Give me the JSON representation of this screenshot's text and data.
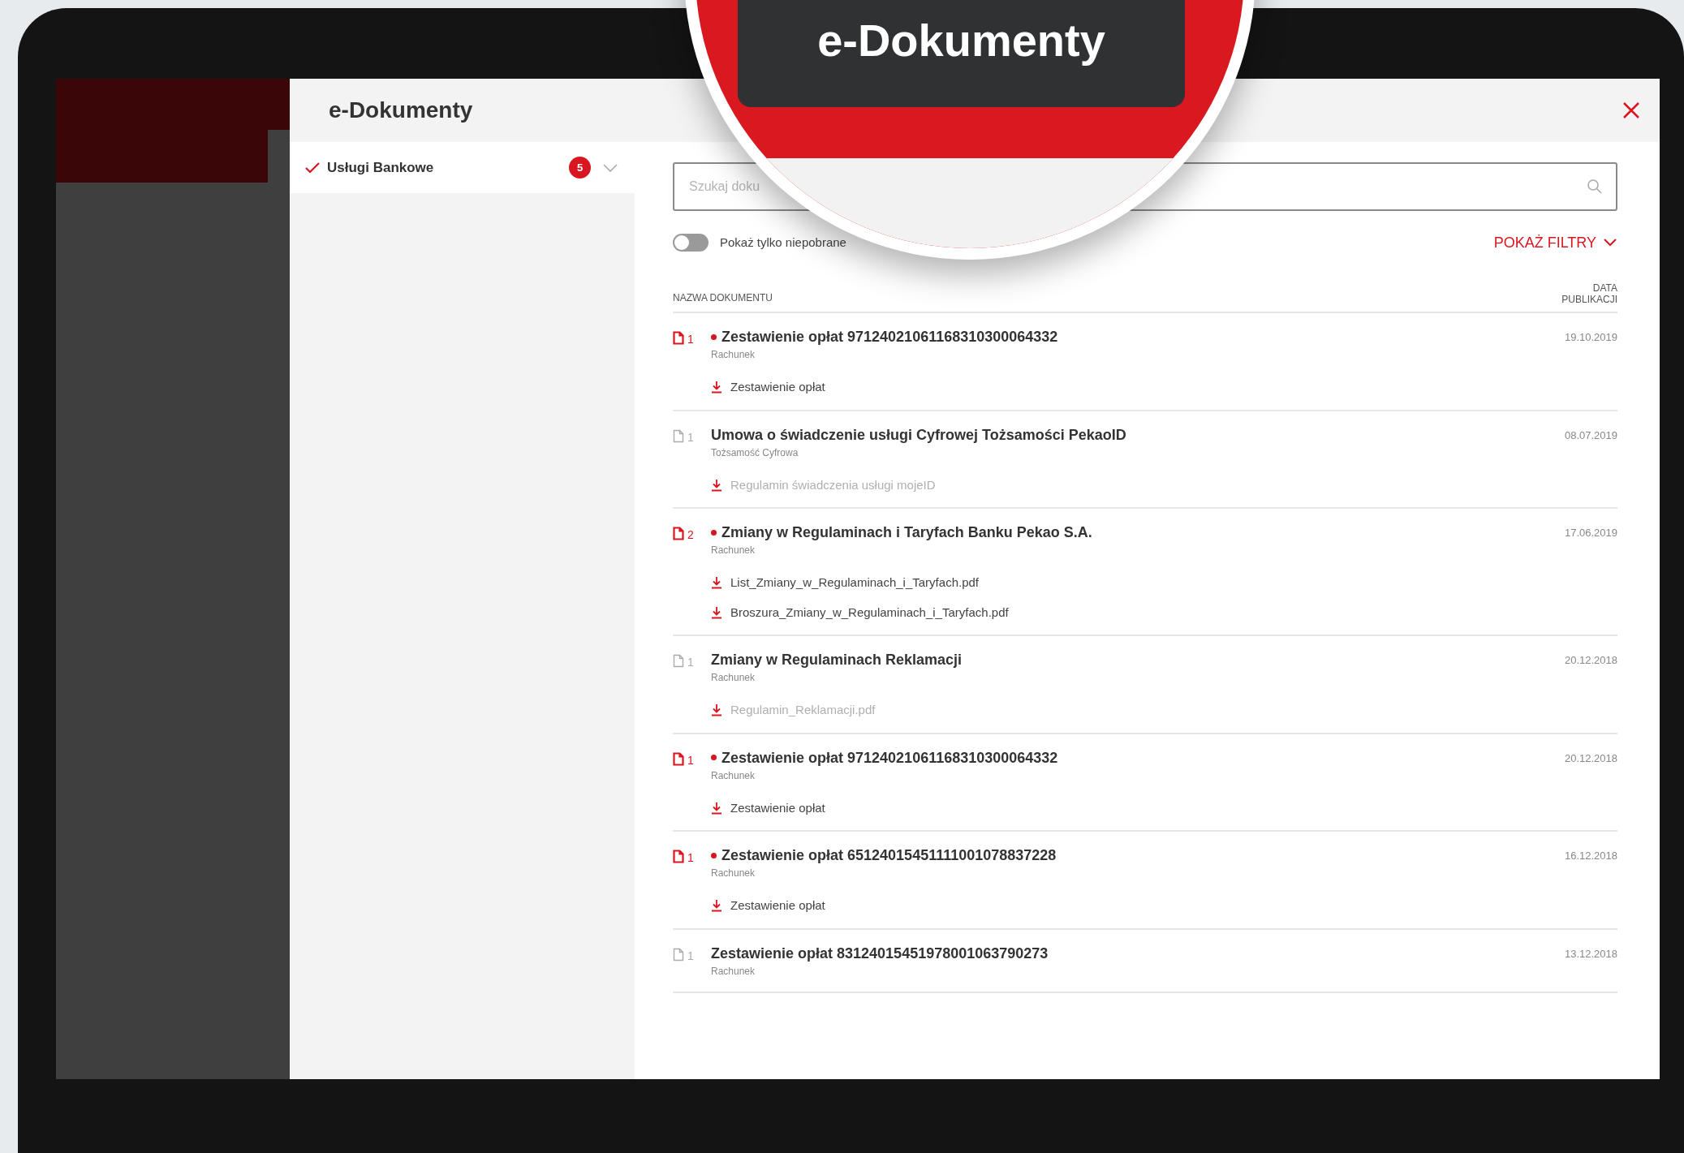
{
  "magnifier": {
    "title": "e-Dokumenty"
  },
  "modal": {
    "title": "e-Dokumenty"
  },
  "sidebar": {
    "items": [
      {
        "label": "Usługi Bankowe",
        "count": "5",
        "selected": true
      }
    ]
  },
  "search": {
    "placeholder": "Szukaj doku"
  },
  "toggle": {
    "label": "Pokaż tylko niepobrane",
    "on": false
  },
  "filters_button": "POKAŻ FILTRY",
  "columns": [
    "NAZWA DOKUMENTU",
    "DATA PUBLIKACJI"
  ],
  "documents": [
    {
      "count": "1",
      "unread": true,
      "title": "Zestawienie opłat 97124021061168310300064332",
      "category": "Rachunek",
      "date": "19.10.2019",
      "attachments": [
        {
          "name": "Zestawienie opłat",
          "downloaded": false
        }
      ]
    },
    {
      "count": "1",
      "unread": false,
      "title": "Umowa o świadczenie usługi Cyfrowej Tożsamości PekaoID",
      "category": "Tożsamość Cyfrowa",
      "date": "08.07.2019",
      "attachments": [
        {
          "name": "Regulamin świadczenia usługi mojeID",
          "downloaded": true
        }
      ]
    },
    {
      "count": "2",
      "unread": true,
      "title": "Zmiany w Regulaminach i Taryfach Banku Pekao S.A.",
      "category": "Rachunek",
      "date": "17.06.2019",
      "attachments": [
        {
          "name": "List_Zmiany_w_Regulaminach_i_Taryfach.pdf",
          "downloaded": false
        },
        {
          "name": "Broszura_Zmiany_w_Regulaminach_i_Taryfach.pdf",
          "downloaded": false
        }
      ]
    },
    {
      "count": "1",
      "unread": false,
      "title": "Zmiany w Regulaminach Reklamacji",
      "category": "Rachunek",
      "date": "20.12.2018",
      "attachments": [
        {
          "name": "Regulamin_Reklamacji.pdf",
          "downloaded": true
        }
      ]
    },
    {
      "count": "1",
      "unread": true,
      "title": "Zestawienie opłat 97124021061168310300064332",
      "category": "Rachunek",
      "date": "20.12.2018",
      "attachments": [
        {
          "name": "Zestawienie opłat",
          "downloaded": false
        }
      ]
    },
    {
      "count": "1",
      "unread": true,
      "title": "Zestawienie opłat 65124015451111001078837228",
      "category": "Rachunek",
      "date": "16.12.2018",
      "attachments": [
        {
          "name": "Zestawienie opłat",
          "downloaded": false
        }
      ]
    },
    {
      "count": "1",
      "unread": false,
      "title": "Zestawienie opłat 83124015451978001063790273",
      "category": "Rachunek",
      "date": "13.12.2018"
    }
  ]
}
